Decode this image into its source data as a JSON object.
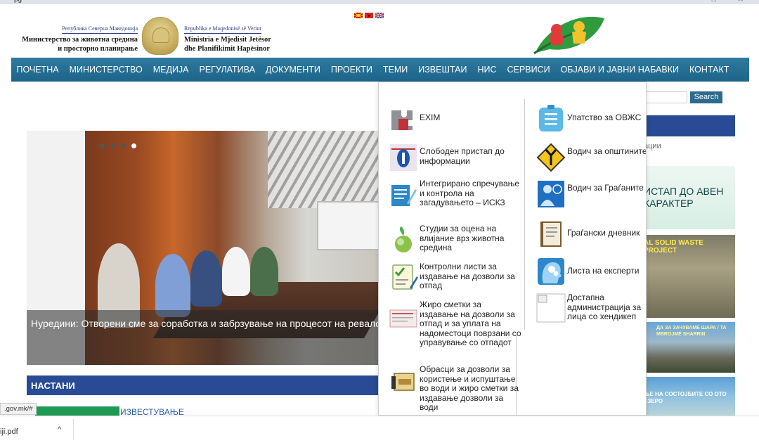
{
  "browser": {
    "url_fragment": "pg",
    "status_url": ".gov.mk/#",
    "download_file": "iji.pdf"
  },
  "header": {
    "mk_small": "Република Северна Македонија",
    "mk_big_1": "Министерство за животна средина",
    "mk_big_2": "и просторно планирање",
    "sq_small": "Republika e Maqedonisë së Veriut",
    "sq_big_1": "Ministria e Mjedisit Jetësor",
    "sq_big_2": "dhe Planifikimit Hapësinor"
  },
  "nav": [
    "ПОЧЕТНА",
    "МИНИСТЕРСТВО",
    "МЕДИЈА",
    "РЕГУЛАТИВА",
    "ДОКУМЕНТИ",
    "ПРОЕКТИ",
    "ТЕМИ",
    "ИЗВЕШТАИ",
    "НИС",
    "СЕРВИСИ",
    "ОБЈАВИ И ЈАВНИ НАБАВКИ",
    "КОНТАКТ"
  ],
  "slider": {
    "caption": "Нуредини: Отворени сме за соработка и забрзување на процесот на ревалор"
  },
  "sections": {
    "nastani": "НАСТАНИ",
    "news_link": "ИЗВЕСТУВАЊЕ"
  },
  "right": {
    "search_button": "Search",
    "text1": "ации",
    "banner": "ИСТАП ДО АВЕН КАРАКТЕР",
    "waste": "AL SOLID WASTE PROJECT",
    "mount": "ДА ЗА ЗАЧУВАМЕ ШАРА / TA MBROJMË SHARRIN",
    "lake": "ЊЕ НА СОСТОЈБИТЕ СО ОТО ЕЗЕРО"
  },
  "dropdown": {
    "left": [
      "EXIM",
      "Слободен пристап до информации",
      "Интегрирано спречување и контрола на загадувањето – ИСКЗ",
      "Студии за оцена на влијание врз животна средина",
      "Контролни листи за издавање на дозволи за отпад",
      "Жиро сметки за издавање на дозволи за отпад и за уплата на надоместоци поврзани со управување со отпадот",
      "Обрасци за дозволи за користење и испуштање во води и жиро сметки за издавање дозволи за води"
    ],
    "right": [
      "Упатство за ОВЖС",
      "Водич за општините",
      "Водич за Граѓаните",
      "Граѓански дневник",
      "Листа на експерти",
      "Достапна администрација за лица со хендикеп"
    ]
  }
}
